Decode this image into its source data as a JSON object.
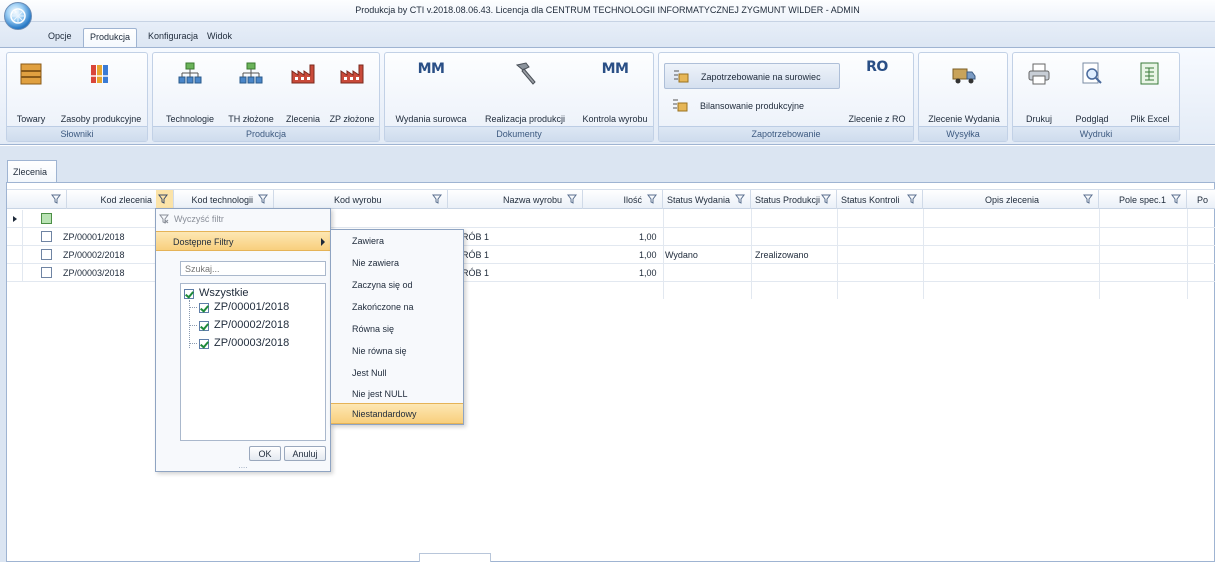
{
  "window": {
    "title": "Produkcja by CTI v.2018.08.06.43. Licencja dla CENTRUM TECHNOLOGII INFORMATYCZNEJ ZYGMUNT WILDER - ADMIN"
  },
  "ribbon_tabs": [
    "Opcje",
    "Produkcja",
    "Konfiguracja",
    "Widok"
  ],
  "ribbon": {
    "groups": {
      "slowniki": {
        "label": "Słowniki",
        "buttons": [
          "Towary",
          "Zasoby produkcyjne"
        ]
      },
      "produkcja": {
        "label": "Produkcja",
        "buttons": [
          "Technologie",
          "TH złożone",
          "Zlecenia",
          "ZP złożone"
        ]
      },
      "dokumenty": {
        "label": "Dokumenty",
        "buttons": [
          "Wydania surowca",
          "Realizacja produkcji",
          "Kontrola wyrobu"
        ],
        "icon_texts": [
          "MM",
          "MM"
        ]
      },
      "zapotrzebowanie": {
        "label": "Zapotrzebowanie",
        "small_buttons": [
          "Zapotrzebowanie na surowiec",
          "Bilansowanie produkcyjne"
        ],
        "buttons": [
          "Zlecenie z RO"
        ],
        "icon_text": "RO"
      },
      "wysylka": {
        "label": "Wysyłka",
        "buttons": [
          "Zlecenie Wydania"
        ]
      },
      "wydruki": {
        "label": "Wydruki",
        "buttons": [
          "Drukuj",
          "Podgląd",
          "Plik Excel"
        ]
      }
    }
  },
  "document_tab": "Zlecenia",
  "grid": {
    "columns": [
      "Kod zlecenia",
      "Kod technologii",
      "Kod wyrobu",
      "Nazwa wyrobu",
      "Ilość",
      "Status Wydania",
      "Status Produkcji",
      "Status Kontroli",
      "Opis zlecenia",
      "Pole spec.1",
      "Po"
    ],
    "rows": [
      {
        "kod": "ZP/00001/2018",
        "nazwa": "RÓB 1",
        "ilosc": "1,00",
        "status_wydania": "",
        "status_produkcji": ""
      },
      {
        "kod": "ZP/00002/2018",
        "nazwa": "RÓB 1",
        "ilosc": "1,00",
        "status_wydania": "Wydano",
        "status_produkcji": "Zrealizowano"
      },
      {
        "kod": "ZP/00003/2018",
        "nazwa": "RÓB 1",
        "ilosc": "1,00",
        "status_wydania": "",
        "status_produkcji": ""
      }
    ]
  },
  "filter_popup": {
    "clear_label": "Wyczyść filtr",
    "available_filters_label": "Dostępne Filtry",
    "search_placeholder": "Szukaj...",
    "tree": {
      "root": "Wszystkie",
      "items": [
        "ZP/00001/2018",
        "ZP/00002/2018",
        "ZP/00003/2018"
      ]
    },
    "ok_label": "OK",
    "cancel_label": "Anuluj",
    "grip": "....",
    "submenu": [
      "Zawiera",
      "Nie zawiera",
      "Zaczyna się od",
      "Zakończone na",
      "Równa się",
      "Nie równa się",
      "Jest Null",
      "Nie jest NULL",
      "Niestandardowy"
    ],
    "submenu_hover_index": 8
  },
  "colors": {
    "ribbon_bg": "#e3ebf6",
    "hover_orange": "#f8cf7d",
    "accent_blue": "#2a4f86"
  }
}
